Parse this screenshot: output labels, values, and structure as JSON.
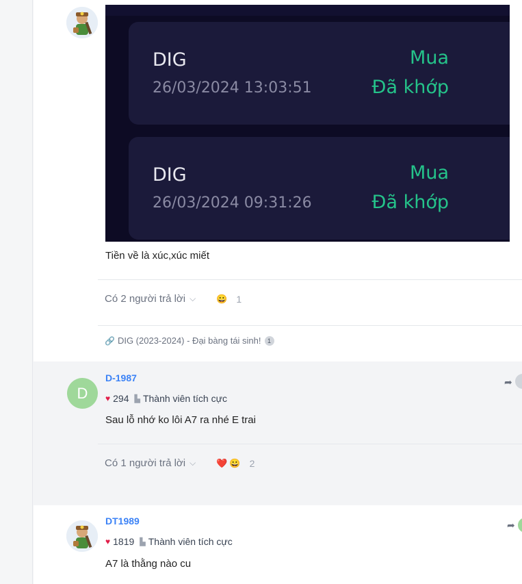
{
  "post": {
    "orders": [
      {
        "ticker": "DIG",
        "time": "26/03/2024 13:03:51",
        "side": "Mua",
        "status": "Đã khớp"
      },
      {
        "ticker": "DIG",
        "time": "26/03/2024 09:31:26",
        "side": "Mua",
        "status": "Đã khớp"
      }
    ],
    "text": "Tiền về là xúc,xúc miết",
    "replies_label": "Có 2 người trả lời",
    "reactions": [
      "😀"
    ],
    "reaction_count": "1",
    "topic": "DIG (2023-2024) - Đại bàng tái sinh!",
    "topic_count": "1"
  },
  "comments": [
    {
      "username": "D-1987",
      "avatar_letter": "D",
      "likes": "294",
      "rank": "Thành viên tích cực",
      "text": "Sau lỗ nhớ ko lôi A7 ra nhé E trai",
      "replies_label": "Có 1 người trả lời",
      "reactions": [
        "❤️",
        "😀"
      ],
      "reaction_count": "2"
    },
    {
      "username": "DT1989",
      "likes": "1819",
      "rank": "Thành viên tích cực",
      "text": "A7 là thằng nào cu"
    }
  ],
  "colors": {
    "accent_green": "#25c38a",
    "username_blue": "#3b82f6",
    "heart_red": "#e11d48",
    "avatar_green": "#9fd89a"
  },
  "icons": {
    "chevron": "chevron-down-icon",
    "link": "link-icon",
    "share": "share-icon",
    "heart": "heart-icon",
    "rank": "rank-icon"
  }
}
